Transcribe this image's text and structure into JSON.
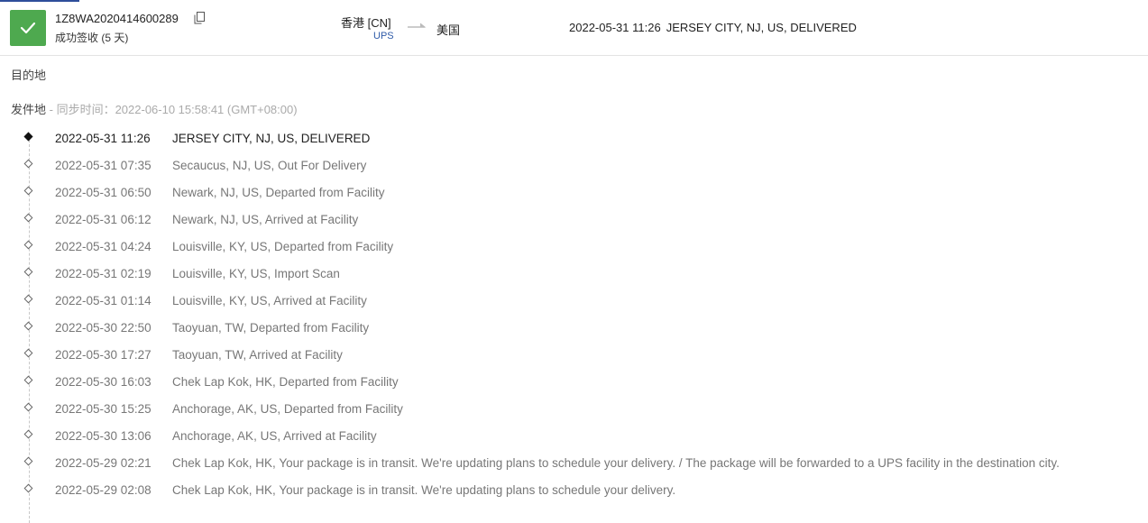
{
  "shipment": {
    "tracking_number": "1Z8WA2020414600289",
    "status": "成功签收 (5 天)",
    "status_color": "#4ea94f",
    "origin": "香港 [CN]",
    "carrier": "UPS",
    "destination": "美国",
    "latest_time": "2022-05-31 11:26",
    "latest_desc": "JERSEY CITY, NJ, US, DELIVERED"
  },
  "sections": {
    "destination_label": "目的地",
    "origin_label": "发件地",
    "sync_text": " - 同步时间：2022-06-10 15:58:41 (GMT+08:00)"
  },
  "events": [
    {
      "time": "2022-05-31 11:26",
      "desc": "JERSEY CITY, NJ, US, DELIVERED"
    },
    {
      "time": "2022-05-31 07:35",
      "desc": "Secaucus, NJ, US, Out For Delivery"
    },
    {
      "time": "2022-05-31 06:50",
      "desc": "Newark, NJ, US, Departed from Facility"
    },
    {
      "time": "2022-05-31 06:12",
      "desc": "Newark, NJ, US, Arrived at Facility"
    },
    {
      "time": "2022-05-31 04:24",
      "desc": "Louisville, KY, US, Departed from Facility"
    },
    {
      "time": "2022-05-31 02:19",
      "desc": "Louisville, KY, US, Import Scan"
    },
    {
      "time": "2022-05-31 01:14",
      "desc": "Louisville, KY, US, Arrived at Facility"
    },
    {
      "time": "2022-05-30 22:50",
      "desc": "Taoyuan, TW, Departed from Facility"
    },
    {
      "time": "2022-05-30 17:27",
      "desc": "Taoyuan, TW, Arrived at Facility"
    },
    {
      "time": "2022-05-30 16:03",
      "desc": "Chek Lap Kok, HK, Departed from Facility"
    },
    {
      "time": "2022-05-30 15:25",
      "desc": "Anchorage, AK, US, Departed from Facility"
    },
    {
      "time": "2022-05-30 13:06",
      "desc": "Anchorage, AK, US, Arrived at Facility"
    },
    {
      "time": "2022-05-29 02:21",
      "desc": "Chek Lap Kok, HK, Your package is in transit. We're updating plans to schedule your delivery. / The package will be forwarded to a UPS facility in the destination city."
    },
    {
      "time": "2022-05-29 02:08",
      "desc": "Chek Lap Kok, HK, Your package is in transit. We're updating plans to schedule your delivery."
    }
  ]
}
